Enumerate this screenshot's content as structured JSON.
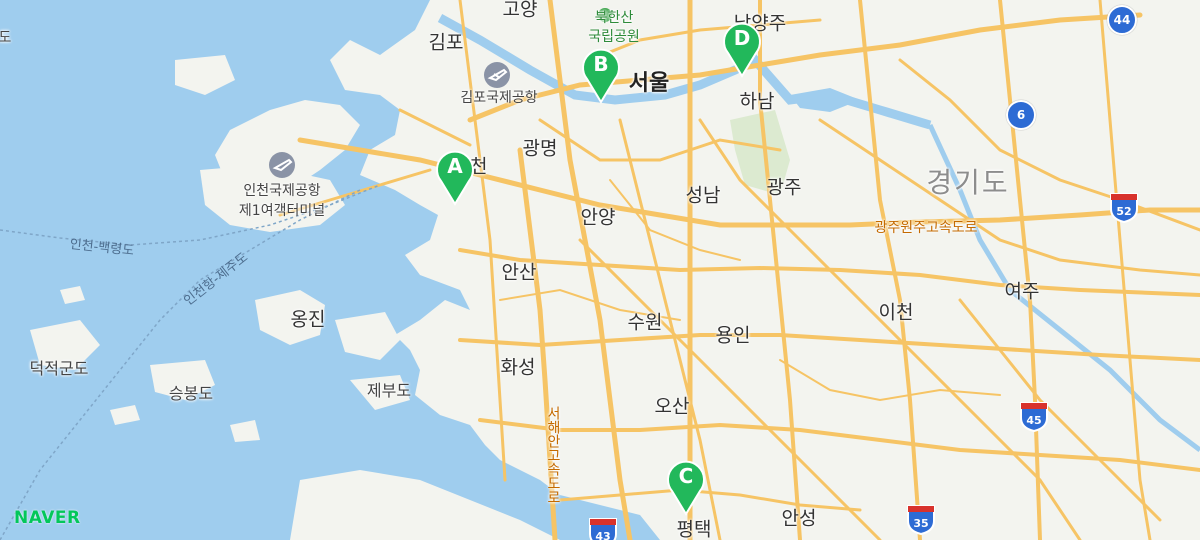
{
  "logo": "NAVER",
  "province": "경기도",
  "labels": {
    "goyang": "고양",
    "gimpo": "김포",
    "seoul": "서울",
    "namyangju": "남양주",
    "hanam": "하남",
    "gimpo_airport": "김포국제공항",
    "incheon": "인천",
    "gwangmyeong": "광명",
    "seongnam": "성남",
    "gwangju": "광주",
    "anyang": "안양",
    "ansan": "안산",
    "suwon": "수원",
    "yongin": "용인",
    "icheon": "이천",
    "yeoju": "여주",
    "hwaseong": "화성",
    "osan": "오산",
    "pyeongtaek": "평택",
    "anseong": "안성",
    "ongjin": "옹진",
    "incheon_airport_1": "인천국제공항",
    "incheon_airport_2": "제1여객터미널",
    "deokjeokgundo": "덕적군도",
    "seungbongdo": "승봉도",
    "jebudo": "제부도",
    "bukhansan_1": "북한산",
    "bukhansan_2": "국립공원"
  },
  "routes": {
    "incheon_baengnyeong": "인천-백령도",
    "incheon_jeju": "인천항-제주도",
    "gwangju_wonju_expressway": "광주원주고속도로",
    "west_coast_expressway": "서해안고속도로"
  },
  "shields": [
    "44",
    "6",
    "52",
    "45",
    "35",
    "43"
  ],
  "markers": [
    "A",
    "B",
    "C",
    "D"
  ],
  "colors": {
    "water": "#9fcdee",
    "land": "#f3f4ef",
    "road": "#f6c465",
    "marker": "#22b85b",
    "logo": "#03c75a"
  }
}
